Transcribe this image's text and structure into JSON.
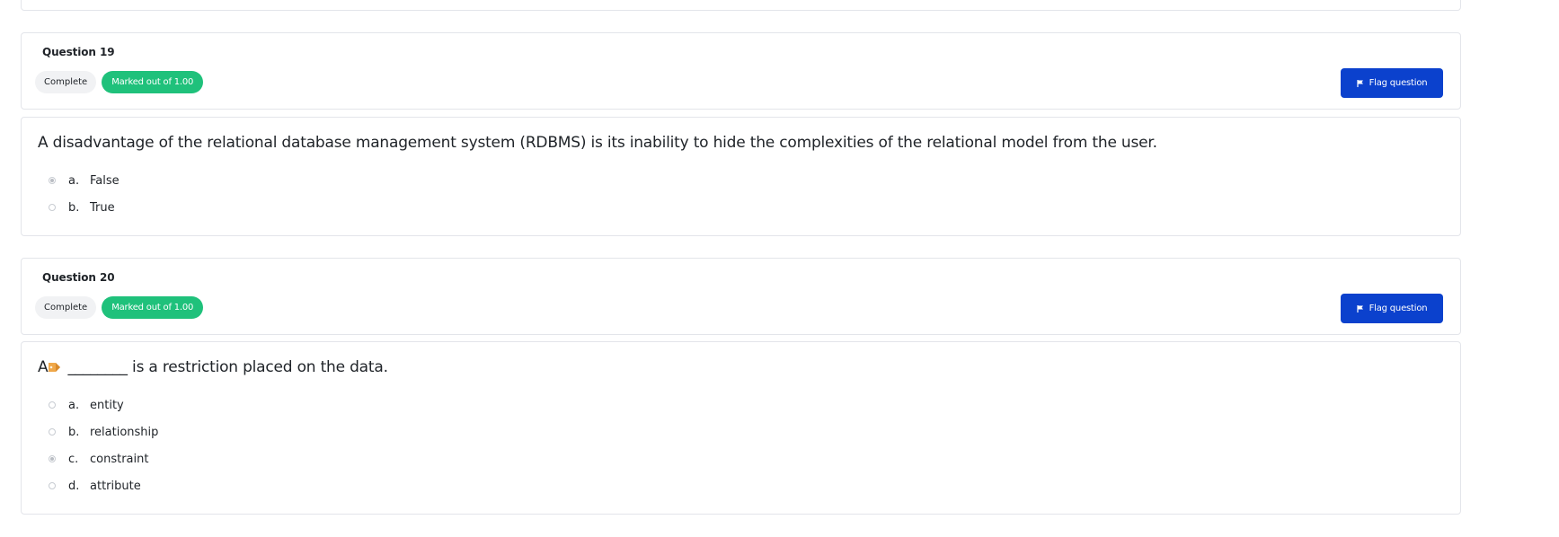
{
  "questions": [
    {
      "title": "Question 19",
      "state": "Complete",
      "mark": "Marked out of 1.00",
      "flag_label": "Flag question",
      "text": "A disadvantage of the relational database management system (RDBMS) is its inability to hide the complexities of the relational model from the user.",
      "answers": [
        {
          "letter": "a.",
          "label": "False",
          "selected": true
        },
        {
          "letter": "b.",
          "label": "True",
          "selected": false
        }
      ]
    },
    {
      "title": "Question 20",
      "state": "Complete",
      "mark": "Marked out of 1.00",
      "flag_label": "Flag question",
      "text_prefix": "A",
      "text": "________ is a restriction placed on the data.",
      "answers": [
        {
          "letter": "a.",
          "label": "entity",
          "selected": false
        },
        {
          "letter": "b.",
          "label": "relationship",
          "selected": false
        },
        {
          "letter": "c.",
          "label": "constraint",
          "selected": true
        },
        {
          "letter": "d.",
          "label": "attribute",
          "selected": false
        }
      ]
    }
  ],
  "colors": {
    "accent": "#0b41cd",
    "marked_badge": "#1fc17b",
    "complete_badge": "#f1f2f4",
    "border": "#e3e5ea"
  },
  "icons": [
    "flag-icon",
    "pencil-icon"
  ]
}
